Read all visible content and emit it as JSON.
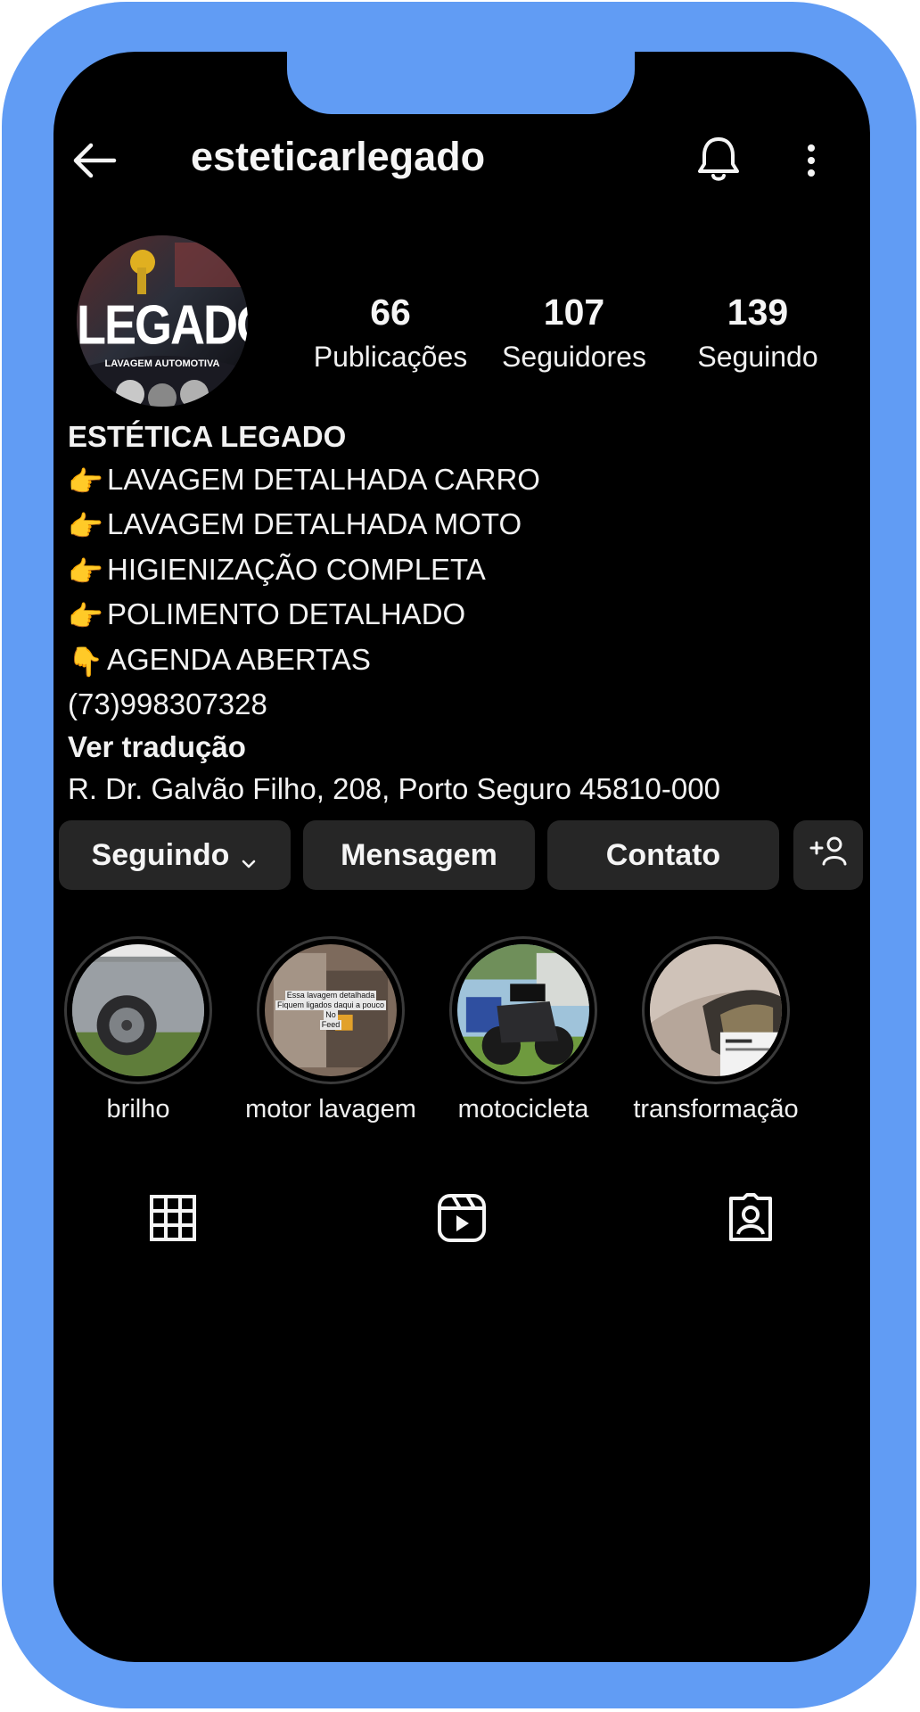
{
  "header": {
    "username": "esteticarlegado"
  },
  "avatar": {
    "brand": "LEGADO",
    "sub": "LAVAGEM AUTOMOTIVA"
  },
  "stats": [
    {
      "value": "66",
      "label": "Publicações"
    },
    {
      "value": "107",
      "label": "Seguidores"
    },
    {
      "value": "139",
      "label": "Seguindo"
    }
  ],
  "bio": {
    "name": "ESTÉTICA LEGADO",
    "lines": [
      {
        "emoji": "👉",
        "text": "LAVAGEM DETALHADA CARRO"
      },
      {
        "emoji": "👉",
        "text": "LAVAGEM DETALHADA MOTO"
      },
      {
        "emoji": "👉",
        "text": "HIGIENIZAÇÃO COMPLETA"
      },
      {
        "emoji": "👉",
        "text": "POLIMENTO DETALHADO"
      },
      {
        "emoji": "👇",
        "text": "AGENDA ABERTAS"
      }
    ],
    "phone": "(73)998307328",
    "translate": "Ver tradução",
    "address": "R. Dr. Galvão Filho, 208, Porto Seguro 45810-000"
  },
  "actions": {
    "following": "Seguindo",
    "message": "Mensagem",
    "contact": "Contato"
  },
  "highlights": [
    {
      "label": "brilho"
    },
    {
      "label": "motor lavagem",
      "caption_lines": [
        "Essa lavagem detalhada",
        "Fiquem ligados daqui a pouco",
        "No",
        "Feed"
      ]
    },
    {
      "label": "motocicleta"
    },
    {
      "label": "transformação"
    }
  ],
  "colors": {
    "frame": "#619cf4",
    "background": "#000000",
    "button": "#262626",
    "text": "#f5f5f5"
  },
  "icons": [
    "back-arrow-icon",
    "bell-icon",
    "more-vertical-icon",
    "chevron-down-icon",
    "add-person-icon",
    "grid-icon",
    "reels-icon",
    "tagged-icon"
  ]
}
